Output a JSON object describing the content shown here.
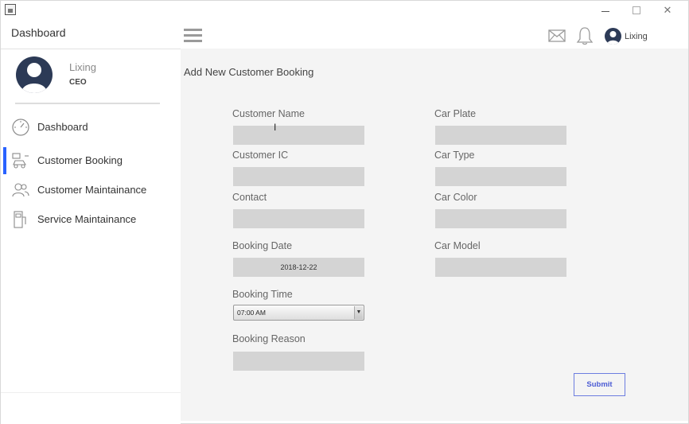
{
  "window": {
    "min_glyph": "",
    "close_glyph": "✕"
  },
  "header": {
    "title": "Dashboard",
    "user_name": "Lixing",
    "icons": [
      "hamburger-icon",
      "mail-icon",
      "bell-icon",
      "avatar"
    ]
  },
  "sidebar": {
    "profile_name": "Lixing",
    "profile_role": "CEO",
    "items": [
      {
        "label": "Dashboard",
        "icon": "speedometer-icon",
        "active": false
      },
      {
        "label": "Customer Booking",
        "icon": "car-booking-icon",
        "active": true
      },
      {
        "label": "Customer Maintainance",
        "icon": "customers-icon",
        "active": false
      },
      {
        "label": "Service Maintainance",
        "icon": "service-icon",
        "active": false
      }
    ],
    "active_color": "#2962ff"
  },
  "main": {
    "title": "Add New Customer Booking",
    "left_fields": {
      "customer_name": "Customer Name",
      "customer_ic": "Customer IC",
      "contact": "Contact",
      "booking_date": "Booking Date",
      "booking_date_value": "2018-12-22",
      "booking_time": "Booking Time",
      "booking_time_value": "07:00 AM",
      "booking_reason": "Booking Reason"
    },
    "right_fields": {
      "car_plate": "Car Plate",
      "car_type": "Car Type",
      "car_color": "Car Color",
      "car_model": "Car Model"
    },
    "submit_label": "Submit",
    "submit_color": "#4c5cd4"
  }
}
